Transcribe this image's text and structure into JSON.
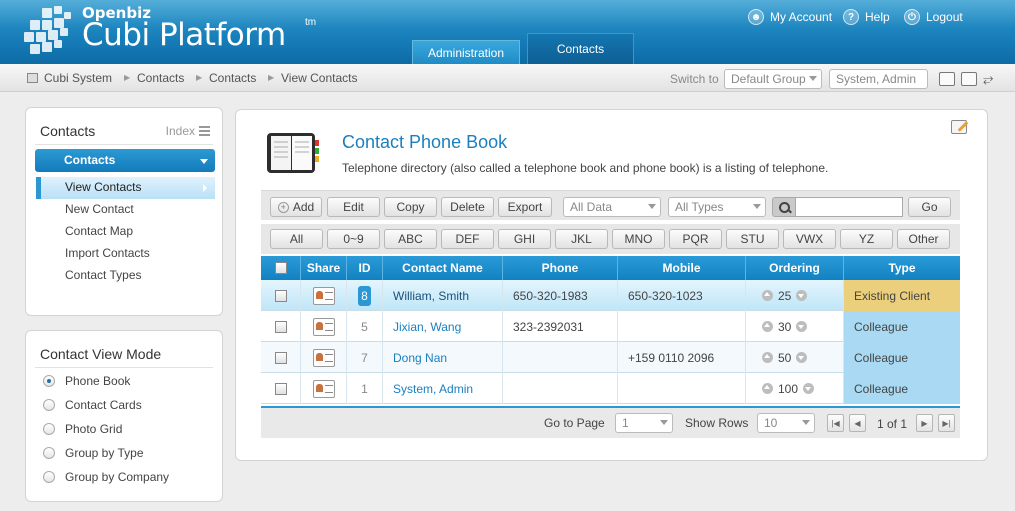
{
  "brand": {
    "small": "Openbiz",
    "big": "Cubi Platform",
    "tm": "tm"
  },
  "top_links": {
    "account": "My Account",
    "help": "Help",
    "logout": "Logout"
  },
  "main_tabs": {
    "admin": "Administration",
    "contacts": "Contacts"
  },
  "breadcrumb": [
    "Cubi System",
    "Contacts",
    "Contacts",
    "View Contacts"
  ],
  "switch": {
    "label": "Switch to",
    "group": "Default Group",
    "user": "System, Admin"
  },
  "nav": {
    "title": "Contacts",
    "index_label": "Index",
    "section": "Contacts",
    "items": [
      "View Contacts",
      "New Contact",
      "Contact Map",
      "Import Contacts",
      "Contact Types"
    ]
  },
  "view_mode": {
    "title": "Contact View Mode",
    "options": [
      "Phone Book",
      "Contact Cards",
      "Photo Grid",
      "Group by Type",
      "Group by Company"
    ],
    "selected": "Phone Book"
  },
  "page": {
    "title": "Contact Phone Book",
    "description": "Telephone directory (also called a telephone book and phone book) is a listing of telephone."
  },
  "toolbar": {
    "add": "Add",
    "edit": "Edit",
    "copy": "Copy",
    "delete": "Delete",
    "export": "Export",
    "filter_data": "All Data",
    "filter_types": "All Types",
    "search_placeholder": "",
    "go": "Go"
  },
  "alpha_filters": [
    "All",
    "0~9",
    "ABC",
    "DEF",
    "GHI",
    "JKL",
    "MNO",
    "PQR",
    "STU",
    "VWX",
    "YZ",
    "Other"
  ],
  "table": {
    "columns": [
      "Share",
      "ID",
      "Contact Name",
      "Phone",
      "Mobile",
      "Ordering",
      "Type"
    ],
    "rows": [
      {
        "id": "8",
        "name": "William, Smith",
        "phone": "650-320-1983",
        "mobile": "650-320-1023",
        "ordering": "25",
        "type": "Existing Client"
      },
      {
        "id": "5",
        "name": "Jixian, Wang",
        "phone": "323-2392031",
        "mobile": "",
        "ordering": "30",
        "type": "Colleague"
      },
      {
        "id": "7",
        "name": "Dong Nan",
        "phone": "",
        "mobile": "+159 0110 2096",
        "ordering": "50",
        "type": "Colleague"
      },
      {
        "id": "1",
        "name": "System, Admin",
        "phone": "",
        "mobile": "",
        "ordering": "100",
        "type": "Colleague"
      }
    ]
  },
  "pager": {
    "goto_label": "Go to Page",
    "page": "1",
    "rows_label": "Show Rows",
    "rows": "10",
    "info": "1 of 1"
  },
  "colors": {
    "header": "#1479b5",
    "accent": "#2b98d5",
    "type_client": "#eccf7d",
    "type_colleague": "#a9d9f3"
  }
}
